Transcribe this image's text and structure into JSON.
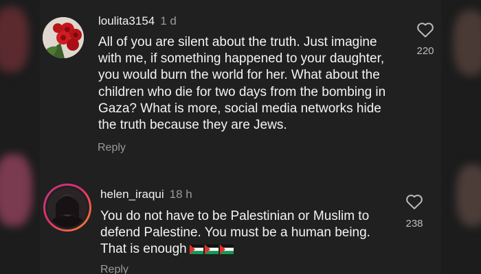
{
  "comments": [
    {
      "username": "loulita3154",
      "time": "1 d",
      "lines": [
        "All of you are silent about the truth. Just imagine",
        "with me, if something happened to your daughter,",
        "you would burn the world for her. What about the",
        "children who die for two days from the bombing in",
        "Gaza? What is more, social media networks hide",
        "the truth because they are Jews."
      ],
      "reply_label": "Reply",
      "likes": "220",
      "avatar_icon": "red-roses-avatar",
      "like_icon": "heart-outline-icon"
    },
    {
      "username": "helen_iraqui",
      "time": "18 h",
      "lines": [
        "You do not have to be Palestinian or Muslim to",
        "defend Palestine. You must be a human being.",
        "That is enough"
      ],
      "reply_label": "Reply",
      "likes": "238",
      "avatar_icon": "story-ring-avatar",
      "like_icon": "heart-outline-icon",
      "emoji": [
        "palestine-flag-emoji",
        "palestine-flag-emoji",
        "palestine-flag-emoji"
      ]
    }
  ],
  "colors": {
    "background": "#202020",
    "text": "#f2f2f2",
    "secondary_text": "#9a9a9a",
    "rose_red": "#c4161c",
    "story_ring_start": "#c13584",
    "story_ring_end": "#f58529"
  }
}
